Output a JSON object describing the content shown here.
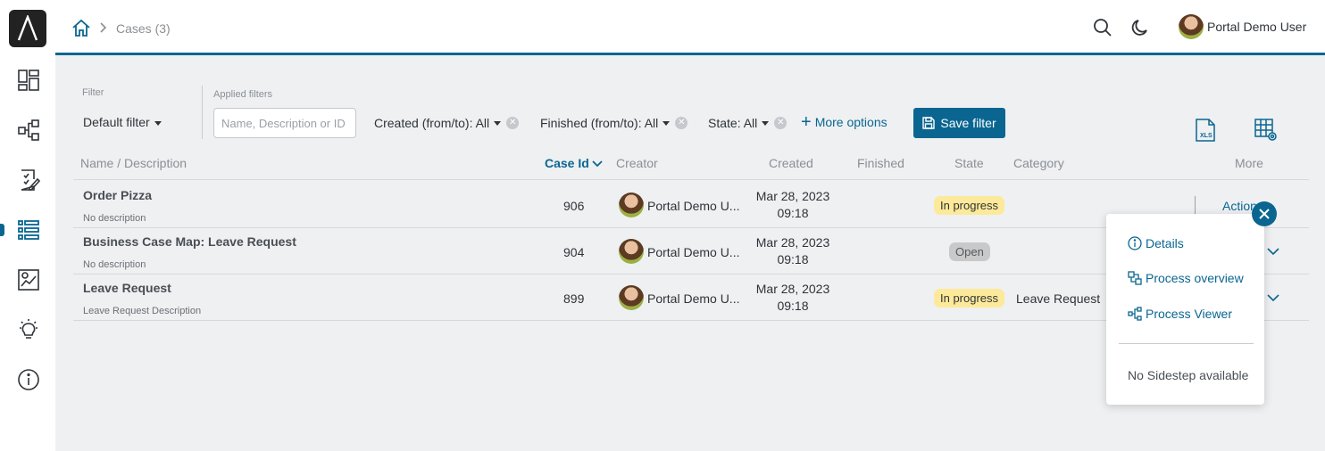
{
  "sidebar": {
    "logo": "Λ",
    "items": [
      {
        "icon": "dashboard-icon"
      },
      {
        "icon": "process-icon"
      },
      {
        "icon": "tasks-icon"
      },
      {
        "icon": "cases-icon"
      },
      {
        "icon": "statistics-icon"
      },
      {
        "icon": "lightbulb-icon"
      },
      {
        "icon": "info-icon"
      }
    ]
  },
  "header": {
    "breadcrumb": "Cases (3)",
    "user_name": "Portal Demo User"
  },
  "filters": {
    "filter_label": "Filter",
    "default_filter": "Default filter",
    "applied_label": "Applied filters",
    "search_placeholder": "Name, Description or ID",
    "created": "Created (from/to): All",
    "finished": "Finished (from/to): All",
    "state": "State: All",
    "more_options": "More options",
    "save_filter": "Save filter"
  },
  "table": {
    "columns": {
      "name": "Name / Description",
      "case_id": "Case Id",
      "creator": "Creator",
      "created": "Created",
      "finished": "Finished",
      "state": "State",
      "category": "Category",
      "more": "More"
    },
    "rows": [
      {
        "name": "Order Pizza",
        "description": "No description",
        "id": "906",
        "creator": "Portal Demo U...",
        "created_date": "Mar 28, 2023",
        "created_time": "09:18",
        "state": "In progress",
        "category": ""
      },
      {
        "name": "Business Case Map: Leave Request",
        "description": "No description",
        "id": "904",
        "creator": "Portal Demo U...",
        "created_date": "Mar 28, 2023",
        "created_time": "09:18",
        "state": "Open",
        "category": ""
      },
      {
        "name": "Leave Request",
        "description": "Leave Request Description",
        "id": "899",
        "creator": "Portal Demo U...",
        "created_date": "Mar 28, 2023",
        "created_time": "09:18",
        "state": "In progress",
        "category": "Leave Request"
      }
    ],
    "actions_label": "Actions"
  },
  "popup": {
    "details": "Details",
    "process_overview": "Process overview",
    "process_viewer": "Process Viewer",
    "no_sidestep": "No Sidestep available"
  },
  "colors": {
    "accent": "#0a6690",
    "in_progress": "#fde99a",
    "open": "#c9c9c9"
  }
}
